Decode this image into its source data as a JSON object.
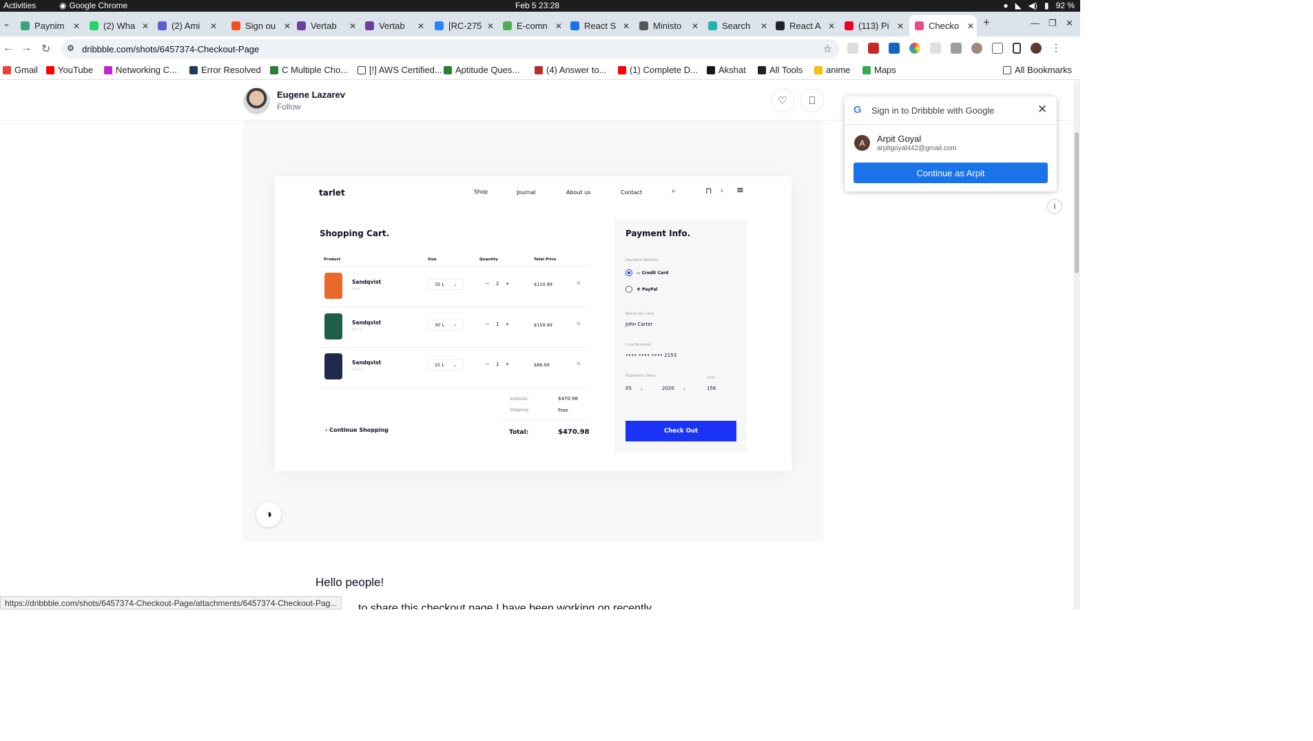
{
  "system": {
    "activities": "Activities",
    "app_name": "Google Chrome",
    "clock": "Feb 5  23:28",
    "battery": "92 %"
  },
  "tabs": [
    {
      "title": "Paynim",
      "color": "#3aa57a"
    },
    {
      "title": "(2) Wha",
      "color": "#25d366"
    },
    {
      "title": "(2) Ami",
      "color": "#5b5fc7"
    },
    {
      "title": "Sign ou",
      "color": "#f25022"
    },
    {
      "title": "Vertab",
      "color": "#6b3fa0"
    },
    {
      "title": "Vertab",
      "color": "#6b3fa0"
    },
    {
      "title": "[RC-275",
      "color": "#2684ff"
    },
    {
      "title": "E-comn",
      "color": "#4caf50"
    },
    {
      "title": "React S",
      "color": "#1a73e8"
    },
    {
      "title": "Ministo",
      "color": "#555555"
    },
    {
      "title": "Search",
      "color": "#20b2aa"
    },
    {
      "title": "React A",
      "color": "#20232a"
    },
    {
      "title": "(113) Pi",
      "color": "#e60023"
    },
    {
      "title": "Checko",
      "color": "#ea4c89"
    }
  ],
  "address": {
    "url": "dribbble.com/shots/6457374-Checkout-Page"
  },
  "bookmarks": [
    {
      "label": "Gmail",
      "color": "#ea4335"
    },
    {
      "label": "YouTube",
      "color": "#ff0000"
    },
    {
      "label": "Networking C...",
      "color": "#c026d3"
    },
    {
      "label": "Error Resolved",
      "color": "#1e3a5f"
    },
    {
      "label": "C Multiple Cho...",
      "color": "#2e7d32"
    },
    {
      "label": "[!] AWS Certified...",
      "color": "#ffffff"
    },
    {
      "label": "Aptitude Ques...",
      "color": "#2e7d32"
    },
    {
      "label": "(4) Answer to...",
      "color": "#b92b27"
    },
    {
      "label": "(1) Complete D...",
      "color": "#ff0000"
    },
    {
      "label": "Akshat",
      "color": "#181717"
    },
    {
      "label": "All Tools",
      "color": "#222222"
    },
    {
      "label": "anime",
      "color": "#f4c20d"
    },
    {
      "label": "Maps",
      "color": "#34a853"
    }
  ],
  "all_bookmarks": "All Bookmarks",
  "author": {
    "name": "Eugene Lazarev",
    "follow": "Follow"
  },
  "shot": {
    "brand": "tarlet",
    "nav": [
      "Shop",
      "Journal",
      "About us",
      "Contact"
    ],
    "cart_count": "3",
    "cart_title": "Shopping Cart.",
    "headers": {
      "product": "Product",
      "size": "Size",
      "quantity": "Quantity",
      "total": "Total Price"
    },
    "items": [
      {
        "name": "Sandqvist",
        "sub": "Zack",
        "size": "35 L",
        "qty": "2",
        "price": "$110.99",
        "color": "#e8692a"
      },
      {
        "name": "Sandqvist",
        "sub": "Bernt",
        "size": "30 L",
        "qty": "1",
        "price": "$159.99",
        "color": "#1f5f4a"
      },
      {
        "name": "Sandqvist",
        "sub": "Zack S",
        "size": "25 L",
        "qty": "1",
        "price": "$89.99",
        "color": "#1d2a4d"
      }
    ],
    "subtotal_label": "Subtotal:",
    "subtotal": "$470.98",
    "shipping_label": "Shipping:",
    "shipping": "Free",
    "continue": "Continue Shopping",
    "total_label": "Total:",
    "total": "$470.98",
    "payment": {
      "title": "Payment Info.",
      "method_label": "Payment Method:",
      "credit_card": "Credit Card",
      "paypal": "PayPal",
      "name_label": "Name On Card:",
      "name": "John Carter",
      "number_label": "Card Number:",
      "number": "••••  ••••  ••••  2153",
      "exp_label": "Expiration Date:",
      "exp_month": "05",
      "exp_year": "2020",
      "cvv_label": "CVV:",
      "cvv": "156",
      "checkout": "Check Out"
    },
    "accent": "#1b33f5"
  },
  "content": {
    "hello": "Hello people!",
    "desc": "to share this checkout page I have been working on recently."
  },
  "status_url": "https://dribbble.com/shots/6457374-Checkout-Page/attachments/6457374-Checkout-Pag...",
  "google_popup": {
    "title": "Sign in to Dribbble with Google",
    "avatar_letter": "A",
    "name": "Arpit Goyal",
    "email": "arpitgoyal442@gmail.com",
    "button": "Continue as Arpit"
  }
}
